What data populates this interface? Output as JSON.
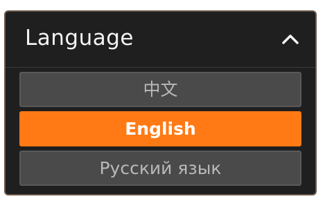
{
  "language_menu": {
    "title": "Language",
    "expanded_icon": "chevron-up-icon",
    "options": [
      {
        "label": "中文",
        "selected": false
      },
      {
        "label": "English",
        "selected": true
      },
      {
        "label": "Русский язык",
        "selected": false
      }
    ]
  },
  "colors": {
    "panel_background": "#1f1f1f",
    "option_background": "#4a4a4a",
    "selected_accent": "#ff7a14",
    "title_text": "#f4f4f4",
    "option_text": "#b9b9b9"
  }
}
